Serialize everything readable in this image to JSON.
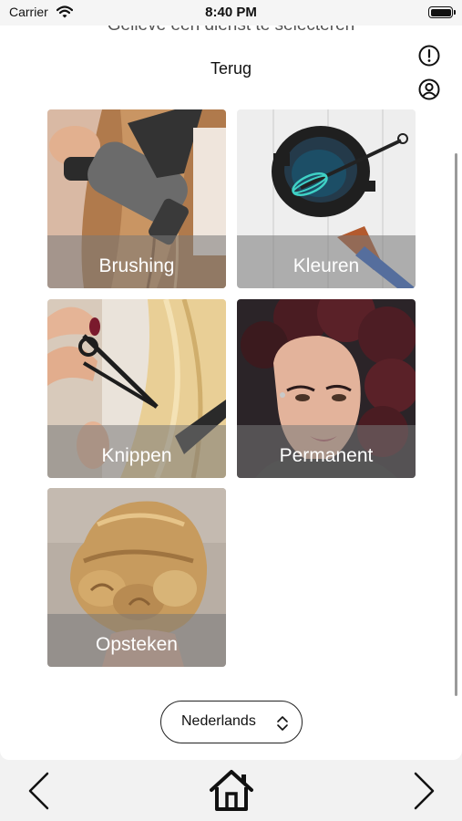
{
  "status_bar": {
    "carrier": "Carrier",
    "time": "8:40 PM",
    "wifi_icon": "wifi-icon",
    "battery_icon": "battery-full-icon"
  },
  "header": {
    "subtitle": "Gelieve een dienst te selecteren",
    "back_label": "Terug",
    "info_icon": "exclamation-circle-icon",
    "profile_icon": "user-circle-icon"
  },
  "services": [
    {
      "label": "Brushing"
    },
    {
      "label": "Kleuren"
    },
    {
      "label": "Knippen"
    },
    {
      "label": "Permanent"
    },
    {
      "label": "Opsteken"
    }
  ],
  "language": {
    "selected": "Nederlands",
    "icon": "updown-chevron-icon"
  },
  "bottom_nav": {
    "back_icon": "chevron-left-icon",
    "home_icon": "home-icon",
    "next_icon": "chevron-right-icon"
  },
  "colors": {
    "background": "#f2f2f2",
    "card": "#ffffff",
    "tile_label_band": "#787878",
    "text": "#111111"
  }
}
